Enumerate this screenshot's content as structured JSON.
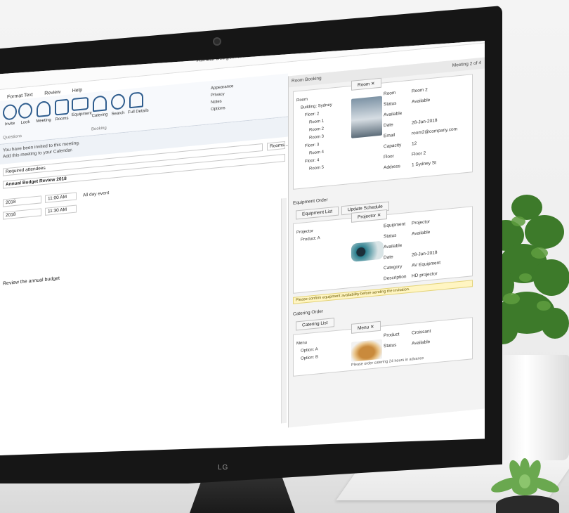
{
  "window": {
    "title": "Annual Budget Review 2018 — Meeting",
    "controls": [
      "—",
      "☐",
      "✕"
    ]
  },
  "ribbon": {
    "tabs": [
      "Format Text",
      "Review",
      "Help"
    ],
    "buttons": [
      "Meeting",
      "Rooms",
      "Equipment",
      "Catering",
      "Search",
      "Full Details"
    ],
    "left_labels": [
      "Invite",
      "Look"
    ],
    "small_items": [
      "Appearance",
      "Privacy",
      "Notes",
      "Options"
    ],
    "group_label": "Booking",
    "left_group_label": "Questions"
  },
  "form": {
    "info_line1": "You have been invited to this meeting.",
    "info_line2": "Add this meeting to your Calendar.",
    "to_placeholder": "Required attendees",
    "subject": "Annual Budget Review 2018",
    "start_date": "2018",
    "start_time": "11:00 AM",
    "end_date": "2018",
    "end_time": "11:30 AM",
    "all_day": "All day event",
    "location_btn": "Rooms...",
    "body": "Review the annual budget"
  },
  "right_pane": {
    "header": "Room Booking",
    "header_right": "Meeting 2 of 4",
    "room_tab": "Room ✕",
    "room_tree": [
      "Room",
      "Building: Sydney",
      "Floor: 2",
      "Room 1",
      "Room 2",
      "Room 3",
      "Floor: 3",
      "Room 4",
      "Floor: 4",
      "Room 5"
    ],
    "room_props": [
      {
        "k": "Room",
        "v": "Room 2"
      },
      {
        "k": "Status",
        "v": "Available"
      },
      {
        "k": "Available Date",
        "v": "28-Jan-2018"
      },
      {
        "k": "Email",
        "v": "room2@company.com"
      },
      {
        "k": "Capacity",
        "v": "12"
      },
      {
        "k": "Floor",
        "v": "Floor 2"
      },
      {
        "k": "Address",
        "v": "1 Sydney St"
      }
    ],
    "equipment_title": "Equipment Order",
    "equipment_tabs": [
      "Equipment List",
      "Update Schedule"
    ],
    "equipment_subtab": "Projector ✕",
    "equipment_tree": [
      "Projector",
      "Product: A"
    ],
    "equipment_props": [
      {
        "k": "Equipment",
        "v": "Projector"
      },
      {
        "k": "Status",
        "v": "Available"
      },
      {
        "k": "Available Date",
        "v": "28-Jan-2018"
      },
      {
        "k": "Category",
        "v": "AV Equipment"
      },
      {
        "k": "Description",
        "v": "HD projector"
      }
    ],
    "warning": "Please confirm equipment availability before sending the invitation.",
    "catering_title": "Catering Order",
    "catering_tabs": [
      "Catering List"
    ],
    "catering_subtab": "Menu ✕",
    "catering_tree": [
      "Menu",
      "Option: A",
      "Option: B"
    ],
    "catering_props": [
      {
        "k": "Product",
        "v": "Croissant"
      },
      {
        "k": "Status",
        "v": "Available"
      }
    ],
    "catering_caption": "Please order catering 24 hours in advance"
  },
  "brand": {
    "monitor_logo": "LG"
  },
  "colors": {
    "accent": "#2f5d8e",
    "bezel": "#161616",
    "warning_bg": "#fff5c2",
    "plant_green": "#3d7a2a"
  }
}
